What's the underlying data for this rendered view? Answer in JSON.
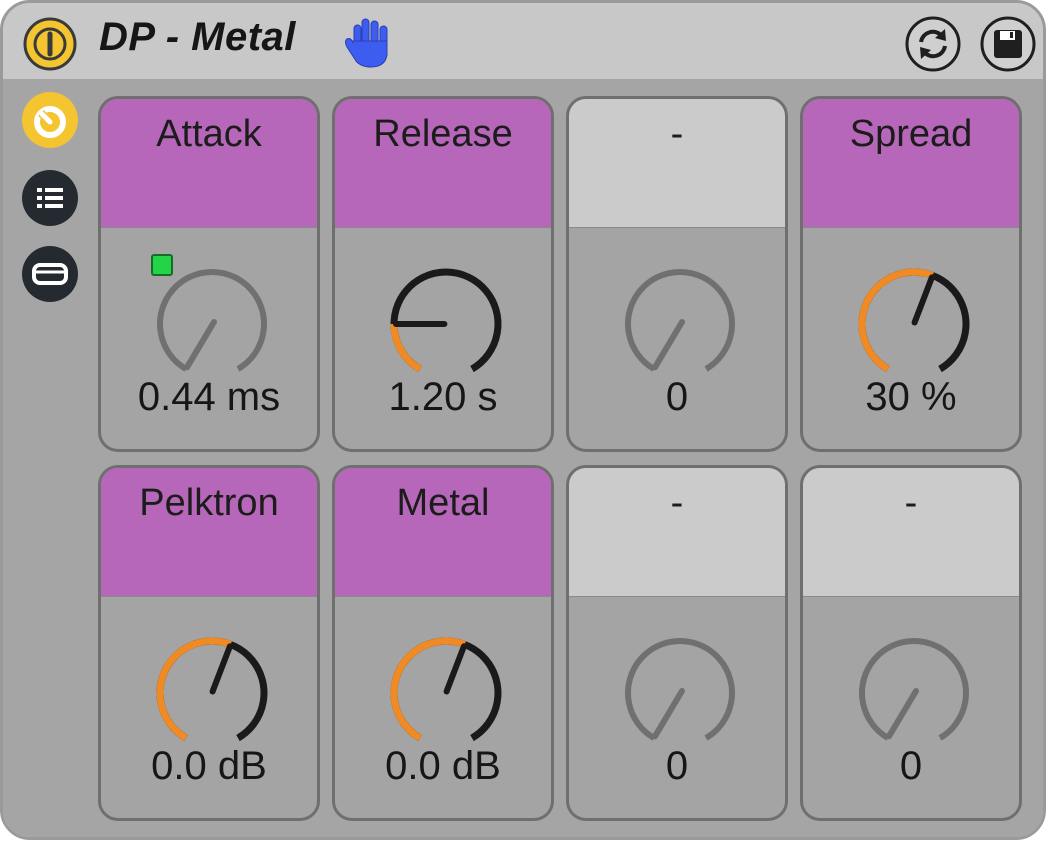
{
  "device": {
    "title": "DP - Metal",
    "header_icons": [
      "power-icon",
      "hand-icon",
      "refresh-icon",
      "save-icon"
    ],
    "side_icons": [
      "knob-view-icon",
      "list-icon",
      "panel-icon"
    ]
  },
  "colors": {
    "accent_orange": "#f08a24",
    "power_yellow": "#f4c530",
    "macro_assigned": "#b767b9",
    "macro_unassigned": "#cbcbcb",
    "hand_blue": "#3d5cf0",
    "mod_green": "#23d446"
  },
  "macros": [
    {
      "label": "Attack",
      "value": "0.44 ms",
      "assigned": true,
      "position": 0.0,
      "modulated": true
    },
    {
      "label": "Release",
      "value": "1.20 s",
      "assigned": true,
      "position": 0.2,
      "modulated": false
    },
    {
      "label": "-",
      "value": "0",
      "assigned": false,
      "position": 0.0,
      "modulated": false
    },
    {
      "label": "Spread",
      "value": "30 %",
      "assigned": true,
      "position": 0.57,
      "modulated": false
    },
    {
      "label": "Pelktron",
      "value": "0.0 dB",
      "assigned": true,
      "position": 0.57,
      "modulated": false
    },
    {
      "label": "Metal",
      "value": "0.0 dB",
      "assigned": true,
      "position": 0.57,
      "modulated": false
    },
    {
      "label": "-",
      "value": "0",
      "assigned": false,
      "position": 0.0,
      "modulated": false
    },
    {
      "label": "-",
      "value": "0",
      "assigned": false,
      "position": 0.0,
      "modulated": false
    }
  ]
}
